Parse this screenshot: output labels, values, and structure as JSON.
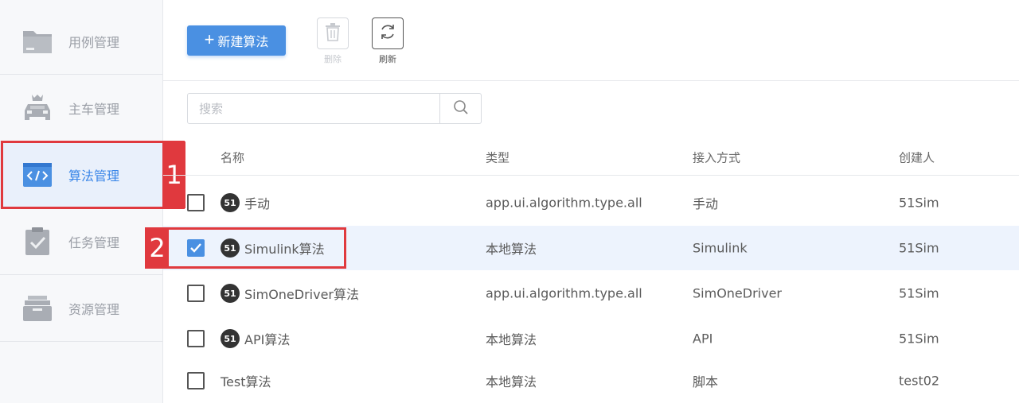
{
  "sidebar": {
    "items": [
      {
        "label": "用例管理",
        "icon": "folder-icon"
      },
      {
        "label": "主车管理",
        "icon": "car-icon"
      },
      {
        "label": "算法管理",
        "icon": "code-icon",
        "active": true
      },
      {
        "label": "任务管理",
        "icon": "clipboard-check-icon"
      },
      {
        "label": "资源管理",
        "icon": "box-icon"
      }
    ]
  },
  "toolbar": {
    "new_label": "新建算法",
    "delete_label": "删除",
    "refresh_label": "刷新"
  },
  "search": {
    "placeholder": "搜索"
  },
  "table": {
    "headers": [
      "名称",
      "类型",
      "接入方式",
      "创建人"
    ],
    "rows": [
      {
        "name": "手动",
        "type": "app.ui.algorithm.type.all",
        "access": "手动",
        "creator": "51Sim",
        "logo": true,
        "checked": false
      },
      {
        "name": "Simulink算法",
        "type": "本地算法",
        "access": "Simulink",
        "creator": "51Sim",
        "logo": true,
        "checked": true
      },
      {
        "name": "SimOneDriver算法",
        "type": "app.ui.algorithm.type.all",
        "access": "SimOneDriver",
        "creator": "51Sim",
        "logo": true,
        "checked": false
      },
      {
        "name": "API算法",
        "type": "本地算法",
        "access": "API",
        "creator": "51Sim",
        "logo": true,
        "checked": false
      },
      {
        "name": "Test算法",
        "type": "本地算法",
        "access": "脚本",
        "creator": "test02",
        "logo": false,
        "checked": false
      }
    ]
  },
  "logo_text": "51",
  "annotations": [
    "1",
    "2"
  ],
  "colors": {
    "accent": "#4a90e2",
    "annotation": "#e0393e",
    "selected_row": "#edf3fd",
    "active_nav": "#e9f0fb"
  }
}
